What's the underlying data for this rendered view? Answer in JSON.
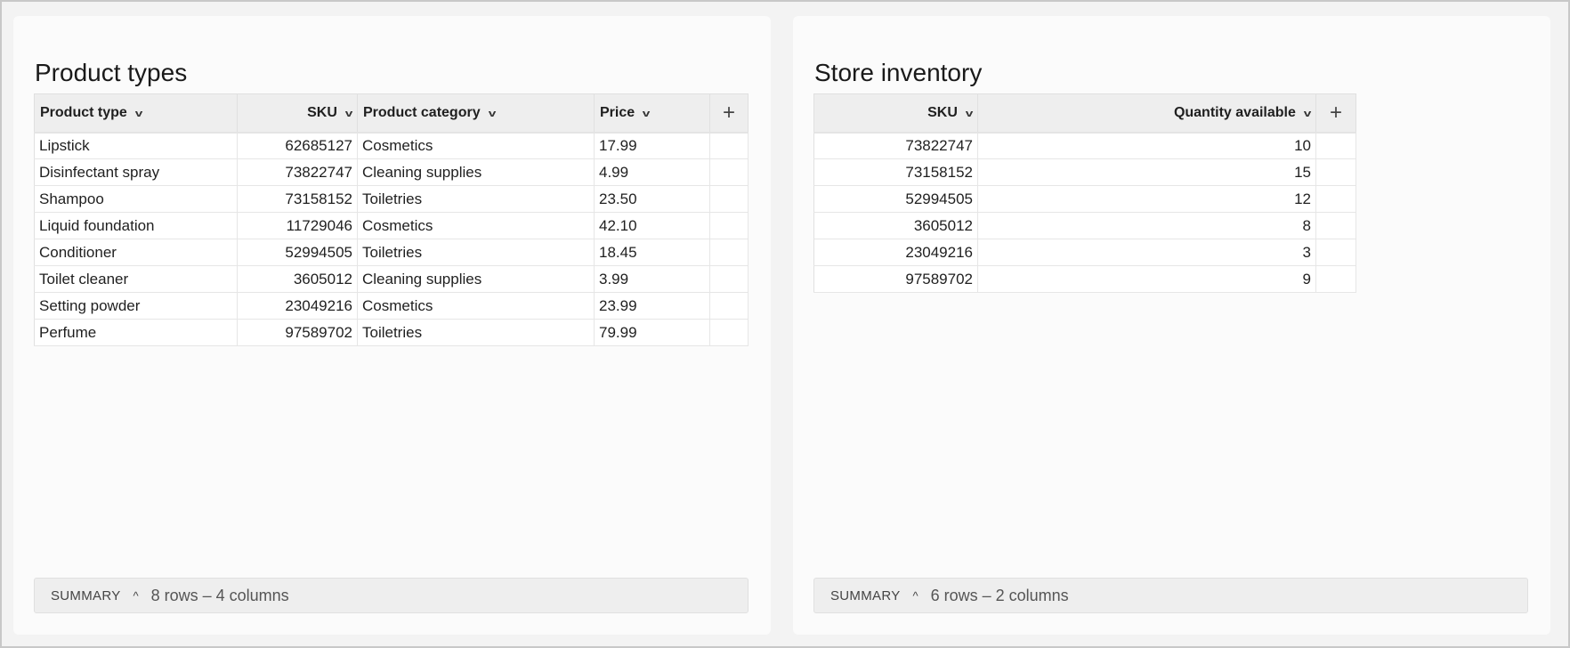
{
  "product_types": {
    "title": "Product types",
    "columns": [
      "Product type",
      "SKU",
      "Product category",
      "Price"
    ],
    "rows": [
      [
        "Lipstick",
        "62685127",
        "Cosmetics",
        "17.99"
      ],
      [
        "Disinfectant spray",
        "73822747",
        "Cleaning supplies",
        "4.99"
      ],
      [
        "Shampoo",
        "73158152",
        "Toiletries",
        "23.50"
      ],
      [
        "Liquid foundation",
        "11729046",
        "Cosmetics",
        "42.10"
      ],
      [
        "Conditioner",
        "52994505",
        "Toiletries",
        "18.45"
      ],
      [
        "Toilet cleaner",
        "3605012",
        "Cleaning supplies",
        "3.99"
      ],
      [
        "Setting powder",
        "23049216",
        "Cosmetics",
        "23.99"
      ],
      [
        "Perfume",
        "97589702",
        "Toiletries",
        "79.99"
      ]
    ],
    "summary_label": "SUMMARY",
    "summary_text": "8 rows – 4 columns"
  },
  "store_inventory": {
    "title": "Store inventory",
    "columns": [
      "SKU",
      "Quantity available"
    ],
    "rows": [
      [
        "73822747",
        "10"
      ],
      [
        "73158152",
        "15"
      ],
      [
        "52994505",
        "12"
      ],
      [
        "3605012",
        "8"
      ],
      [
        "23049216",
        "3"
      ],
      [
        "97589702",
        "9"
      ]
    ],
    "summary_label": "SUMMARY",
    "summary_text": "6 rows – 2 columns"
  },
  "icons": {
    "chevron": "˅",
    "plus": "+",
    "collapse": "^"
  }
}
